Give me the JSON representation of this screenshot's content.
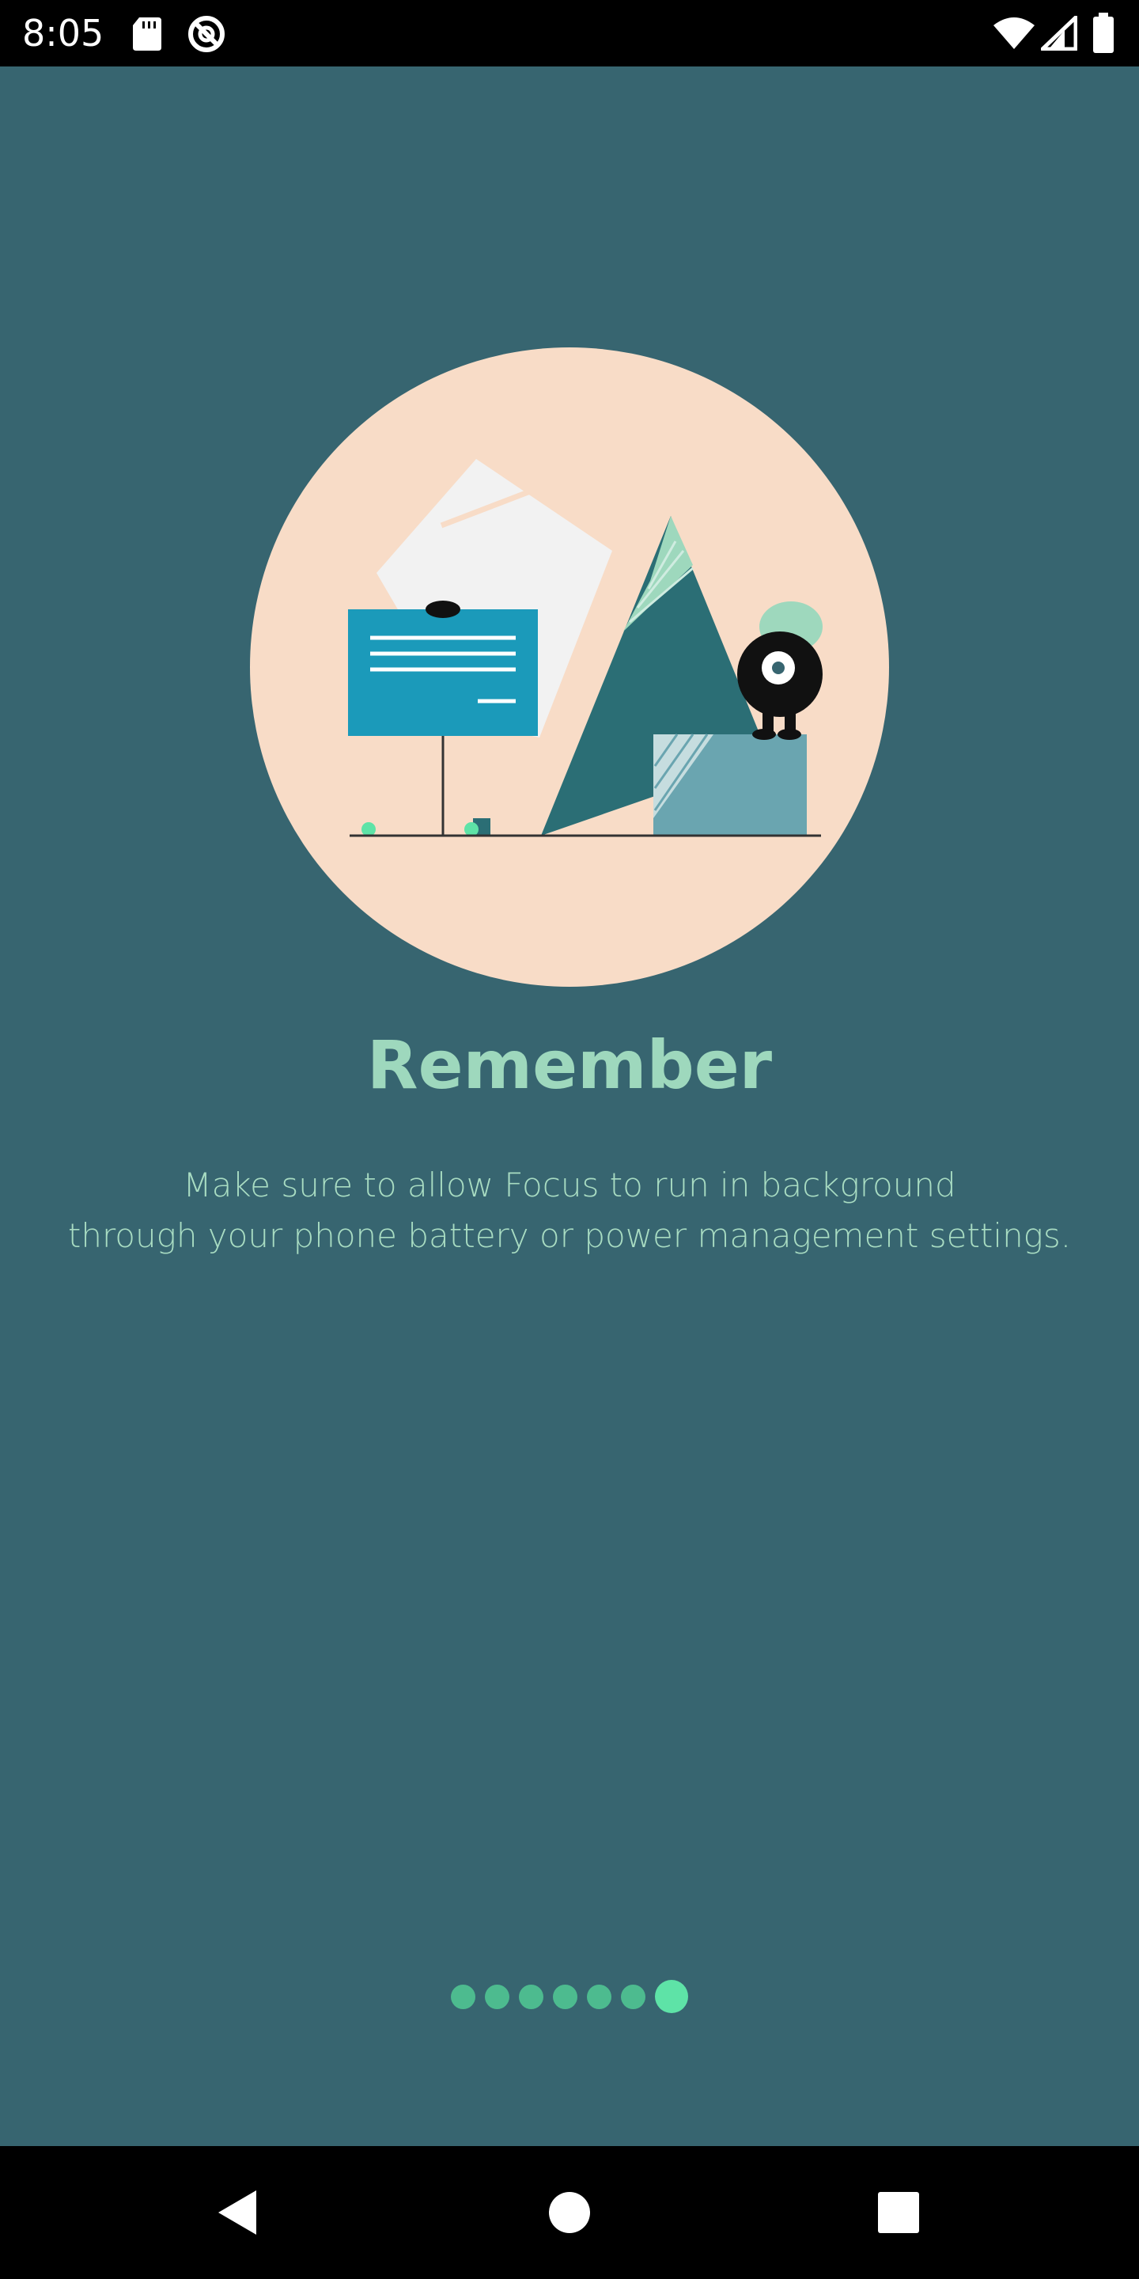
{
  "status_bar": {
    "time": "8:05",
    "icons": [
      "sd-card-icon",
      "no-disturb-icon",
      "wifi-icon",
      "cell-signal-icon",
      "battery-icon"
    ]
  },
  "onboarding": {
    "title": "Remember",
    "description_line1": "Make sure to allow Focus to run in background",
    "description_line2": "through your phone battery or power management settings.",
    "page_count": 7,
    "current_page": 7
  },
  "nav_bar": {
    "buttons": [
      "back-icon",
      "home-icon",
      "recents-icon"
    ]
  },
  "colors": {
    "background": "#376570",
    "title": "#9ed8bd",
    "dot": "#4dbb8f",
    "dot_active": "#5ee3a7"
  }
}
